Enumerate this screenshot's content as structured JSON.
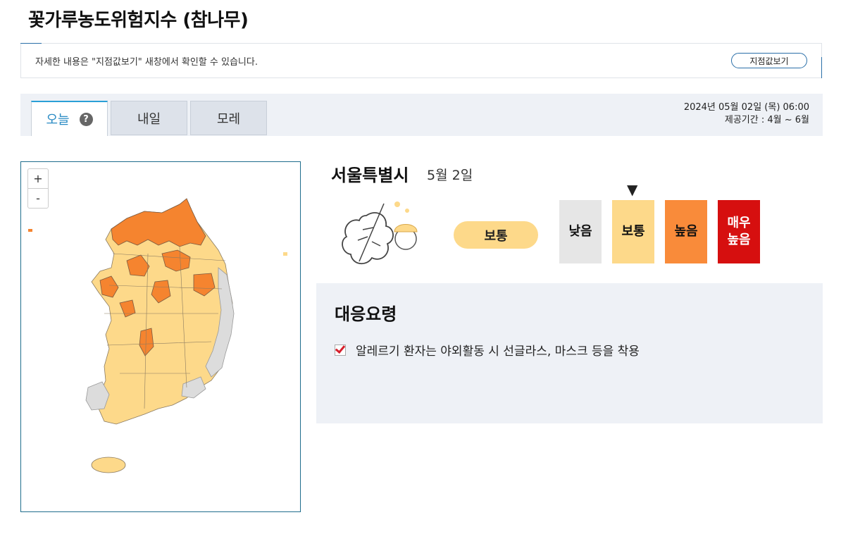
{
  "page": {
    "title": "꽃가루농도위험지수 (참나무)"
  },
  "notice": {
    "text": "자세한 내용은 \"지점값보기\" 새창에서 확인할 수 있습니다.",
    "button_label": "지점값보기"
  },
  "tabs": [
    {
      "label": "오늘",
      "active": true
    },
    {
      "label": "내일",
      "active": false
    },
    {
      "label": "모레",
      "active": false
    }
  ],
  "help_icon": "?",
  "date_info": {
    "datetime": "2024년 05월 02일 (목) 06:00",
    "period": "제공기간 : 4월 ~ 6월"
  },
  "map": {
    "zoom_in": "+",
    "zoom_out": "-",
    "colors": {
      "high": "#f5842f",
      "normal": "#fdd98a",
      "low": "#dcdcdc"
    }
  },
  "region": {
    "name": "서울특별시",
    "date": "5월 2일",
    "level": "보통"
  },
  "levels": [
    {
      "label": "낮음",
      "color": "#e6e6e6",
      "text_color": "#111111"
    },
    {
      "label": "보통",
      "color": "#fdd98a",
      "text_color": "#111111",
      "current": true
    },
    {
      "label": "높음",
      "color": "#f98b3a",
      "text_color": "#111111"
    },
    {
      "label": "매우\n높음",
      "color": "#d60f0f",
      "text_color": "#ffffff"
    }
  ],
  "indicator": "▼",
  "guide": {
    "title": "대응요령",
    "items": [
      "알레르기 환자는 야외활동 시 선글라스, 마스크 등을 착용"
    ]
  }
}
